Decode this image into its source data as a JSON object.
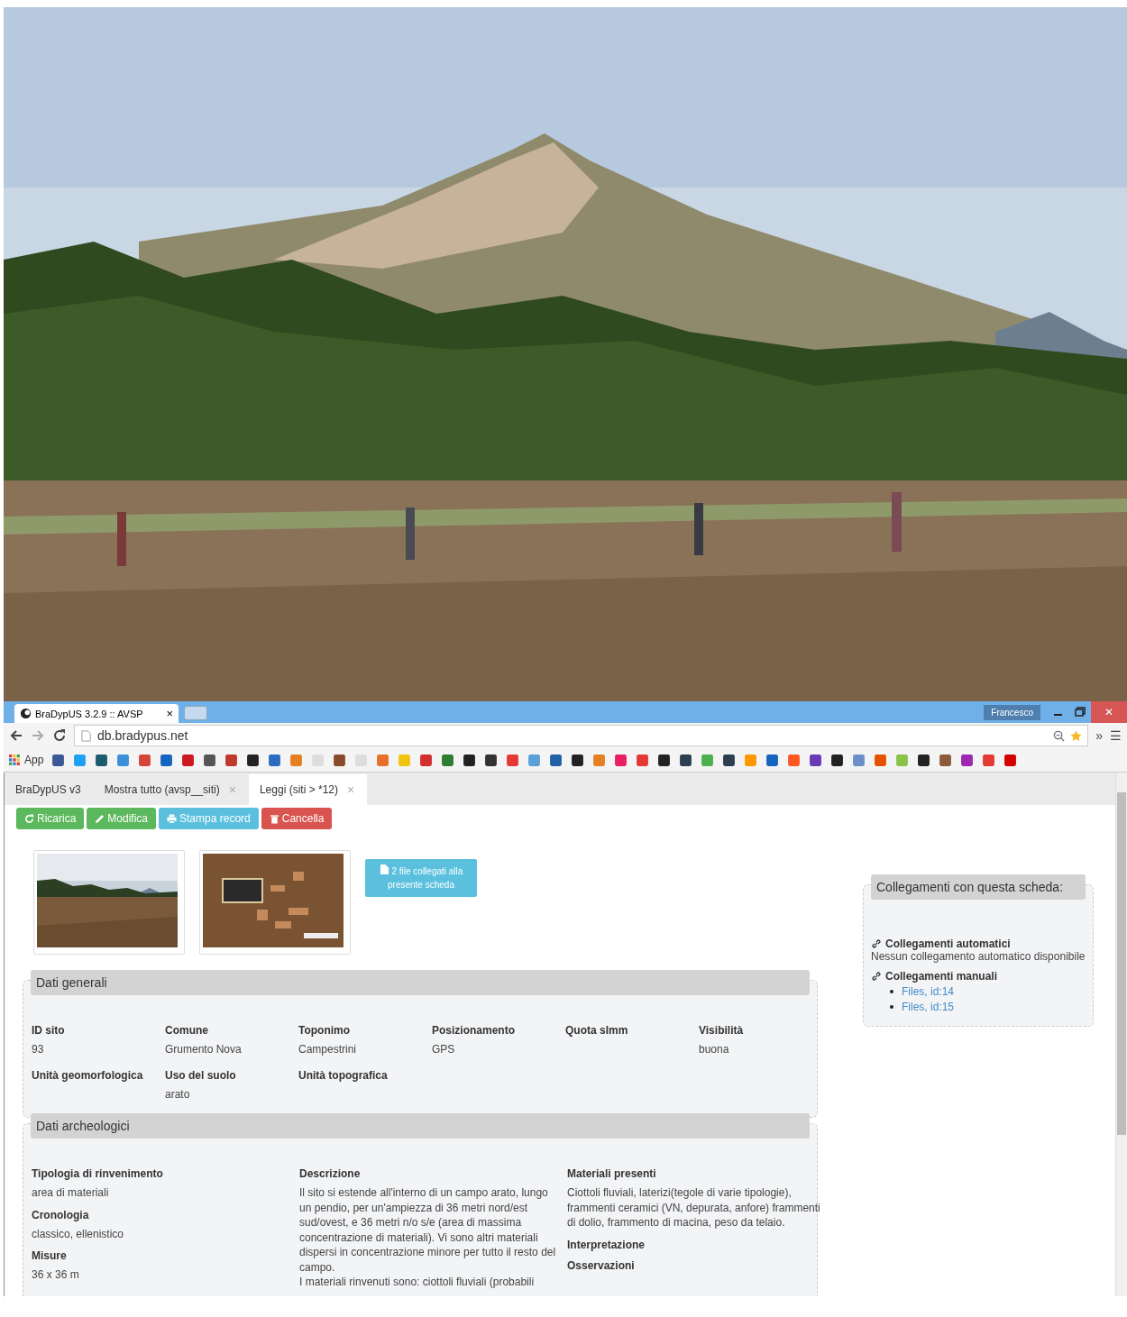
{
  "browser": {
    "tab_title": "BraDypUS 3.2.9 :: AVSP",
    "tab_close": "×",
    "user": "Francesco",
    "close": "✕",
    "url": "db.bradypus.net",
    "overflow": "»",
    "menu": "☰",
    "apps_label": "App"
  },
  "app_tabs": [
    {
      "label": "BraDypUS v3",
      "selected": false
    },
    {
      "label": "Mostra tutto (avsp__siti)",
      "selected": false,
      "close": "×"
    },
    {
      "label": "Leggi (siti > *12)",
      "selected": true,
      "close": "×"
    }
  ],
  "actions": [
    {
      "label": "Ricarica",
      "kind": "success"
    },
    {
      "label": "Modifica",
      "kind": "success"
    },
    {
      "label": "Stampa record",
      "kind": "info"
    },
    {
      "label": "Cancella",
      "kind": "danger"
    }
  ],
  "files_button": "2 file collegati alla presente scheda",
  "sections": [
    {
      "title": "Dati generali",
      "columns": [
        [
          {
            "label": "ID sito",
            "value": "93"
          }
        ],
        [
          {
            "label": "Comune",
            "value": "Grumento Nova"
          }
        ],
        [
          {
            "label": "Toponimo",
            "value": "Campestrini"
          }
        ],
        [
          {
            "label": "Posizionamento",
            "value": "GPS"
          }
        ],
        [
          {
            "label": "Quota slmm"
          }
        ],
        [
          {
            "label": "Visibilità",
            "value": "buona"
          }
        ],
        [
          {
            "label": "Unità geomorfologica"
          }
        ],
        [
          {
            "label": "Uso del suolo",
            "value": "arato"
          }
        ],
        [
          {
            "label": "Unità topografica"
          }
        ]
      ]
    },
    {
      "title": "Dati archeologici",
      "columns": [
        [
          {
            "label": "Tipologia di rinvenimento",
            "value": "area di materiali"
          },
          {
            "label": "Cronologia",
            "value": "classico, ellenistico"
          },
          {
            "label": "Misure",
            "value": "36 x 36 m"
          }
        ],
        [
          {
            "label": "Descrizione",
            "paragraphs": [
              "Il sito si estende all'interno di un campo arato, lungo un pendio, per un'ampiezza di 36 metri nord/est sud/ovest, e 36 metri n/o s/e (area di massima concentrazione di materiali). Vi sono altri materiali dispersi in concentrazione minore per tutto il resto del campo.",
              "I materiali rinvenuti sono: ciottoli fluviali (probabili"
            ]
          }
        ],
        [
          {
            "label": "Materiali presenti",
            "value": "Ciottoli fluviali, laterizi(tegole di varie tipologie), frammenti ceramici (VN, depurata, anfore) frammenti di dolio, frammento di macina, peso da telaio."
          },
          {
            "label": "Interpretazione"
          },
          {
            "label": "Osservazioni"
          }
        ]
      ]
    }
  ],
  "links_panel": {
    "title": "Collegamenti con questa scheda:",
    "auto_title": "Collegamenti automatici",
    "auto_text": "Nessun collegamento automatico disponibile",
    "manual_title": "Collegamenti manuali",
    "manual_links": [
      "Files, id:14",
      "Files, id:15"
    ]
  }
}
